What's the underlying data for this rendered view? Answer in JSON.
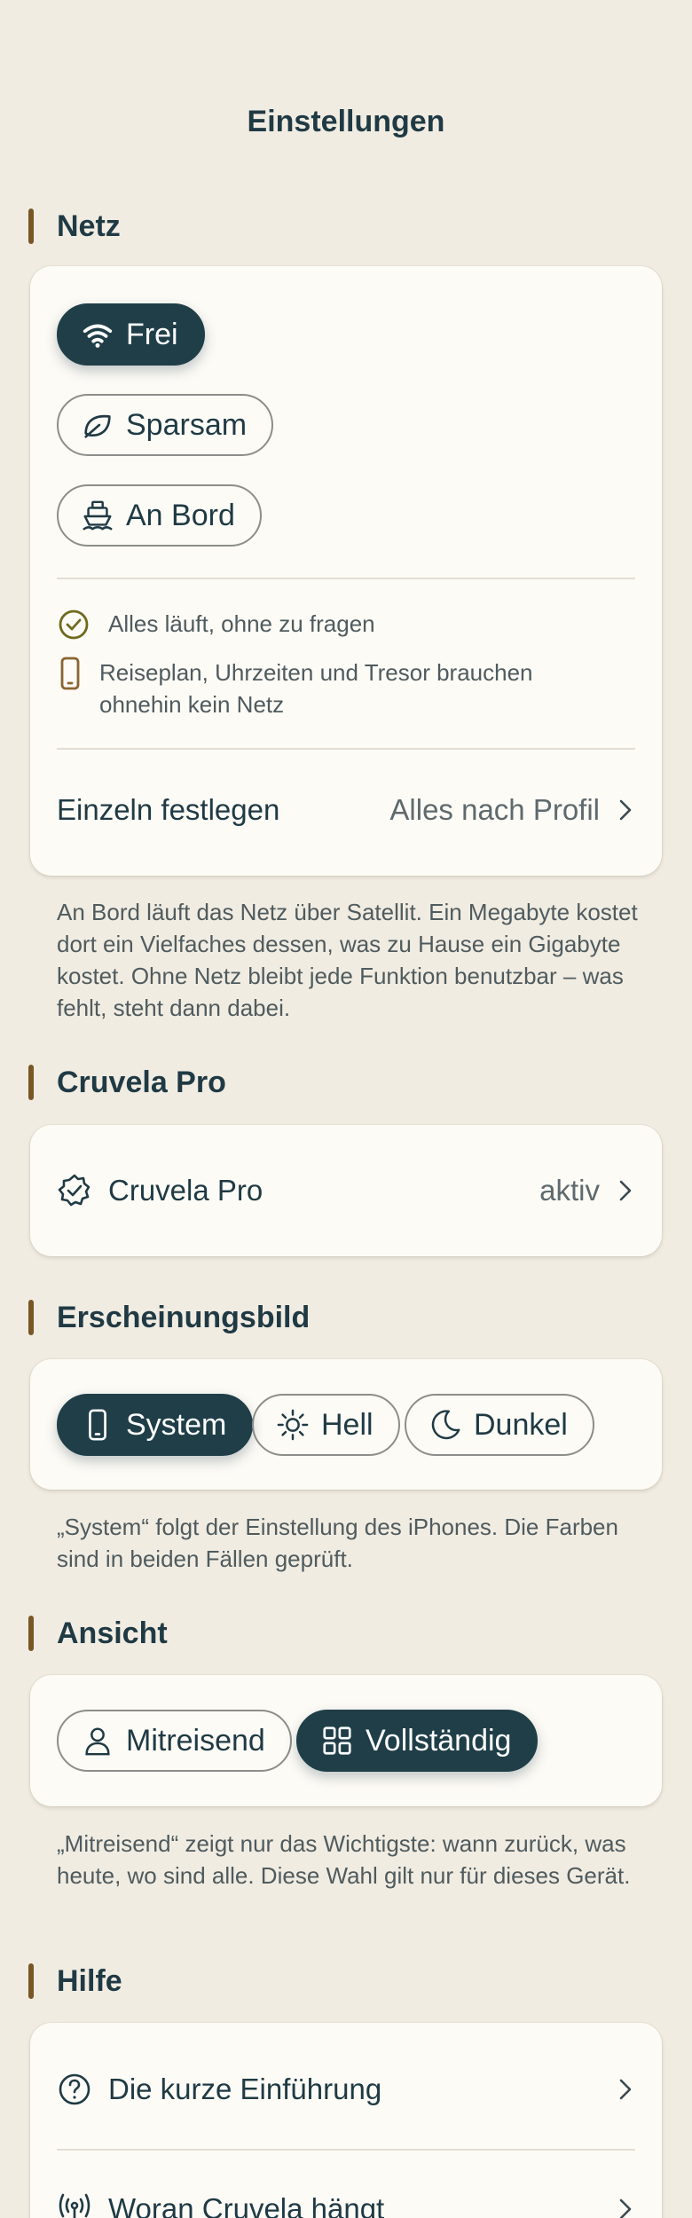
{
  "page": {
    "title": "Einstellungen"
  },
  "network": {
    "section_title": "Netz",
    "options": [
      {
        "label": "Frei",
        "icon": "wifi-icon",
        "selected": true
      },
      {
        "label": "Sparsam",
        "icon": "leaf-icon",
        "selected": false
      },
      {
        "label": "An Bord",
        "icon": "ship-icon",
        "selected": false
      }
    ],
    "status_1": "Alles läuft, ohne zu fragen",
    "status_2": "Reiseplan, Uhrzeiten und Tresor brauchen ohnehin kein Netz",
    "detail_row": {
      "label": "Einzeln festlegen",
      "value": "Alles nach Profil"
    },
    "note": "An Bord läuft das Netz über Satellit. Ein Megabyte kostet dort ein Vielfaches dessen, was zu Hause ein Gigabyte kostet. Ohne Netz bleibt jede Funktion benutzbar – was fehlt, steht dann dabei."
  },
  "pro": {
    "section_title": "Cruvela Pro",
    "row": {
      "label": "Cruvela Pro",
      "value": "aktiv",
      "icon": "badge-check-icon"
    }
  },
  "appearance": {
    "section_title": "Erscheinungsbild",
    "options": [
      {
        "label": "System",
        "icon": "phone-icon",
        "selected": true
      },
      {
        "label": "Hell",
        "icon": "sun-icon",
        "selected": false
      },
      {
        "label": "Dunkel",
        "icon": "moon-icon",
        "selected": false
      }
    ],
    "note": "„System“ folgt der Einstellung des iPhones. Die Farben sind in beiden Fällen geprüft."
  },
  "view": {
    "section_title": "Ansicht",
    "options": [
      {
        "label": "Mitreisend",
        "icon": "person-icon",
        "selected": false
      },
      {
        "label": "Vollständig",
        "icon": "grid-icon",
        "selected": true
      }
    ],
    "note": "„Mitreisend“ zeigt nur das Wichtigste: wann zurück, was heute, wo sind alle. Diese Wahl gilt nur für dieses Gerät."
  },
  "help": {
    "section_title": "Hilfe",
    "rows": [
      {
        "label": "Die kurze Einführung",
        "icon": "question-circle-icon"
      },
      {
        "label": "Woran Cruvela hängt",
        "icon": "antenna-icon"
      }
    ]
  },
  "colors": {
    "background": "#F1ECE2",
    "card": "#FDFBF6",
    "accent_dark": "#1F3E48",
    "section_bar": "#7A5626",
    "check_olive": "#6E6A1E",
    "phone_bronze": "#8A6530"
  }
}
